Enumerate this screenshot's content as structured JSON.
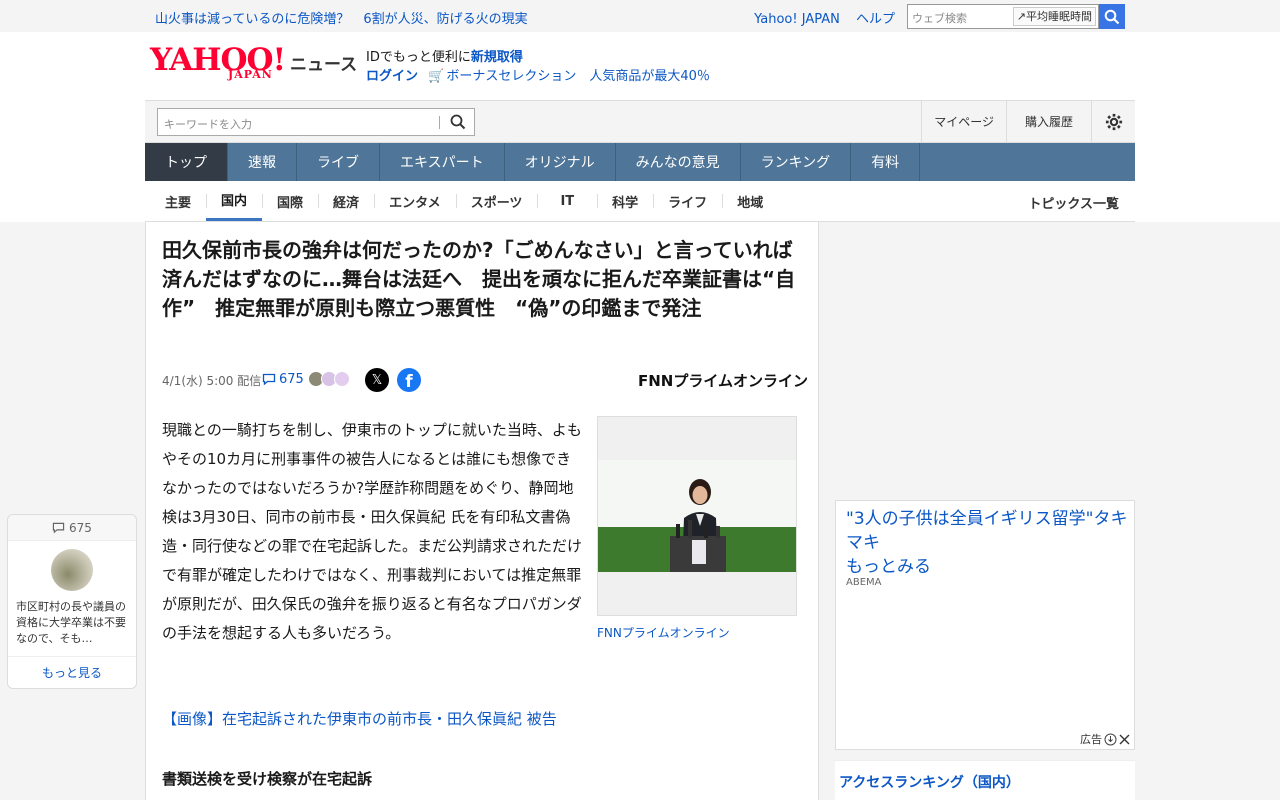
{
  "topbar": {
    "headline_1": "山火事は減っているのに危険増？",
    "headline_2": "6割が人災、防げる火の現実",
    "link_yahoo": "Yahoo! JAPAN",
    "link_help": "ヘルプ",
    "web_search_placeholder": "ウェブ検索",
    "assist_label": "平均睡眠時間"
  },
  "logo": {
    "brand": "YAHOO!",
    "sub": "JAPAN",
    "service": "ニュース"
  },
  "promo": {
    "line1_prefix": "IDでもっと便利に",
    "line1_link": "新規取得",
    "login": "ログイン",
    "bonus": "ボーナスセレクション　人気商品が最大40％"
  },
  "search": {
    "placeholder": "キーワードを入力"
  },
  "header_nav": {
    "mypage": "マイページ",
    "history": "購入履歴"
  },
  "main_nav": [
    "トップ",
    "速報",
    "ライブ",
    "エキスパート",
    "オリジナル",
    "みんなの意見",
    "ランキング",
    "有料"
  ],
  "sub_nav": [
    "主要",
    "国内",
    "国際",
    "経済",
    "エンタメ",
    "スポーツ",
    "IT",
    "科学",
    "ライフ",
    "地域"
  ],
  "sub_nav_topics": "トピックス一覧",
  "article": {
    "title": "田久保前市長の強弁は何だったのか?「ごめんなさい」と言っていれば済んだはずなのに…舞台は法廷へ　提出を頑なに拒んだ卒業証書は“自作”　推定無罪が原則も際立つ悪質性　“偽”の印鑑まで発注",
    "date": "4/1(水) 5:00 配信",
    "comment_count": "675",
    "provider": "FNNプライムオンライン",
    "body": "現職との一騎打ちを制し、伊東市のトップに就いた当時、よもやその10カ月に刑事事件の被告人になるとは誰にも想像できなかったのではないだろうか?学歴詐称問題をめぐり、静岡地検は3月30日、同市の前市長・田久保眞紀 氏を有印私文書偽造・同行使などの罪で在宅起訴した。まだ公判請求されただけで有罪が確定したわけではなく、刑事裁判においては推定無罪が原則だが、田久保氏の強弁を振り返ると有名なプロパガンダの手法を想起する人も多いだろう。",
    "photo_caption": "FNNプライムオンライン",
    "image_link": "【画像】在宅起訴された伊東市の前市長・田久保眞紀 被告",
    "subhead": "書類送検を受け検察が在宅起訴"
  },
  "float_card": {
    "count": "675",
    "snippet": "市区町村の長や議員の資格に大学卒業は不要なので、そも…",
    "more": "もっと見る"
  },
  "ad": {
    "title": "\"3人の子供は全員イギリス留学\"タキマキ\nもっとみる",
    "source": "ABEMA",
    "label": "広告"
  },
  "ranking": {
    "title": "アクセスランキング（国内）"
  },
  "colors": {
    "brand_red": "#ff0033",
    "link_blue": "#0b57c5",
    "nav_blue": "#4f7698",
    "nav_active": "#333b46"
  }
}
